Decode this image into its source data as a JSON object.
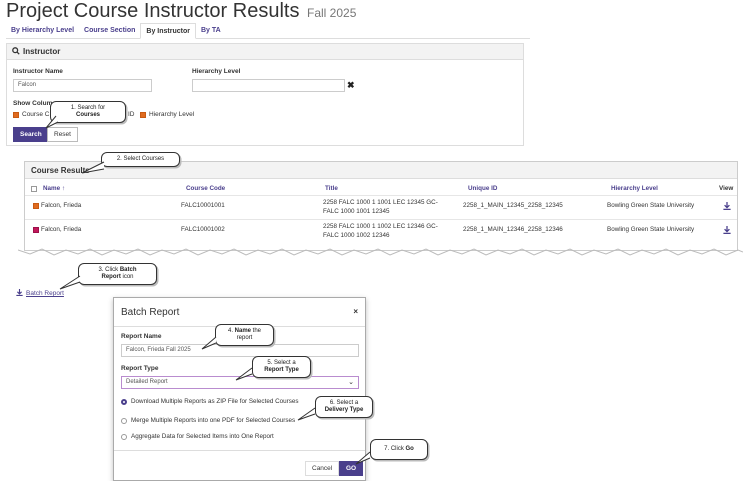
{
  "header": {
    "title": "Project Course Instructor Results",
    "term": "Fall 2025"
  },
  "tabs": [
    {
      "label": "By Hierarchy Level"
    },
    {
      "label": "Course Section"
    },
    {
      "label": "By Instructor"
    },
    {
      "label": "By TA"
    }
  ],
  "instructor_panel": {
    "title": "Instructor",
    "instructor_name_label": "Instructor Name",
    "instructor_name_value": "Falcon",
    "hierarchy_level_label": "Hierarchy Level",
    "hierarchy_level_value": "",
    "show_columns_label": "Show Colum",
    "checkbox_course_partial": "Course C",
    "checkbox_id_partial": "ID",
    "checkbox_hierarchy": "Hierarchy Level",
    "search_button": "Search",
    "reset_button": "Reset"
  },
  "results": {
    "title": "Course Results",
    "columns": [
      "Name ↑",
      "Course Code",
      "Title",
      "Unique ID",
      "Hierarchy Level",
      "View"
    ],
    "rows": [
      {
        "name": "Falcon, Frieda",
        "course_code": "FALC10001001",
        "title_line1": "2258 FALC 1000 1 1001 LEC 12345 GC-",
        "title_line2": "FALC 1000 1001 12345",
        "unique_id": "2258_1_MAIN_12345_2258_12345",
        "hierarchy": "Bowling Green State University"
      },
      {
        "name": "Falcon, Frieda",
        "course_code": "FALC10001002",
        "title_line1": "2258 FALC 1000 1 1002 LEC 12346 GC-",
        "title_line2": "FALC 1000 1002 12346",
        "unique_id": "2258_1_MAIN_12346_2258_12346",
        "hierarchy": "Bowling Green State University"
      }
    ]
  },
  "batch_link": "Batch Report",
  "modal": {
    "title": "Batch Report",
    "report_name_label": "Report Name",
    "report_name_value": "Falcon, Frieda Fall 2025",
    "report_type_label": "Report Type",
    "report_type_value": "Detailed Report",
    "delivery_options": [
      "Download Multiple Reports as ZIP File for Selected Courses",
      "Merge Multiple Reports into one PDF for Selected Courses",
      "Aggregate Data for Selected Items into One Report"
    ],
    "cancel_button": "Cancel",
    "go_button": "GO"
  },
  "callouts": {
    "c1_a": "1. Search for",
    "c1_b": "Courses",
    "c2": "2. Select Courses",
    "c3_a": "3. Click ",
    "c3_b": "Batch",
    "c3_c": "Report",
    "c3_d": " icon",
    "c4_a": "4. ",
    "c4_b": "Name",
    "c4_c": " the",
    "c4_d": "report",
    "c5_a": "5. Select a",
    "c5_b": "Report Type",
    "c6_a": "6. Select a",
    "c6_b": "Delivery Type",
    "c7_a": "7. Click ",
    "c7_b": "Go"
  },
  "colors": {
    "accent": "#4a3f8c",
    "checkbox": "#e06b1f"
  },
  "icons": [
    "search-icon",
    "close-icon",
    "download-icon",
    "chevron-down-icon"
  ]
}
